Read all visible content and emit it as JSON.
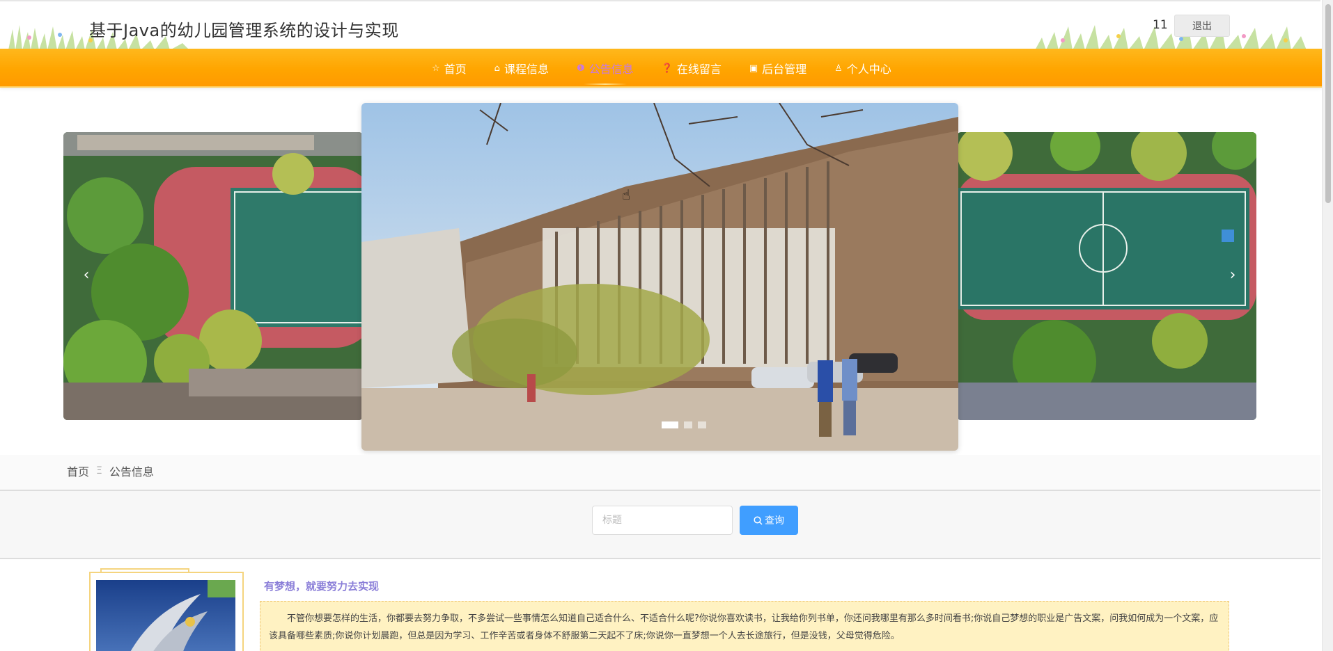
{
  "header": {
    "title": "基于Java的幼儿园管理系统的设计与实现",
    "username": "11",
    "logout_label": "退出"
  },
  "nav": {
    "items": [
      {
        "label": "首页",
        "icon": "star-icon",
        "glyph": "☆"
      },
      {
        "label": "课程信息",
        "icon": "bag-icon",
        "glyph": "⌂"
      },
      {
        "label": "公告信息",
        "icon": "info-circle-icon",
        "glyph": "❶"
      },
      {
        "label": "在线留言",
        "icon": "question-circle-icon",
        "glyph": "❓"
      },
      {
        "label": "后台管理",
        "icon": "cube-icon",
        "glyph": "▣"
      },
      {
        "label": "个人中心",
        "icon": "user-icon",
        "glyph": "♙"
      }
    ],
    "active_index": 2,
    "active_color": "#c678e6",
    "bar_color": "#ffa500"
  },
  "carousel": {
    "prev_glyph": "‹",
    "next_glyph": "›",
    "slide_count": 3,
    "active_slide": 0
  },
  "breadcrumb": {
    "home": "首页",
    "separator": "Ξ",
    "current": "公告信息"
  },
  "search": {
    "placeholder": "标题",
    "value": "",
    "button_label": "查询",
    "button_icon": "search-icon",
    "button_color": "#409eff"
  },
  "news": [
    {
      "title": "有梦想，就要努力去实现",
      "summary": "不管你想要怎样的生活，你都要去努力争取，不多尝试一些事情怎么知道自己适合什么、不适合什么呢?你说你喜欢读书，让我给你列书单，你还问我哪里有那么多时间看书;你说自己梦想的职业是广告文案，问我如何成为一个文案，应该具备哪些素质;你说你计划晨跑，但总是因为学习、工作辛苦或者身体不舒服第二天起不了床;你说你一直梦想一个人去长途旅行，但是没钱，父母觉得危险。"
    }
  ]
}
